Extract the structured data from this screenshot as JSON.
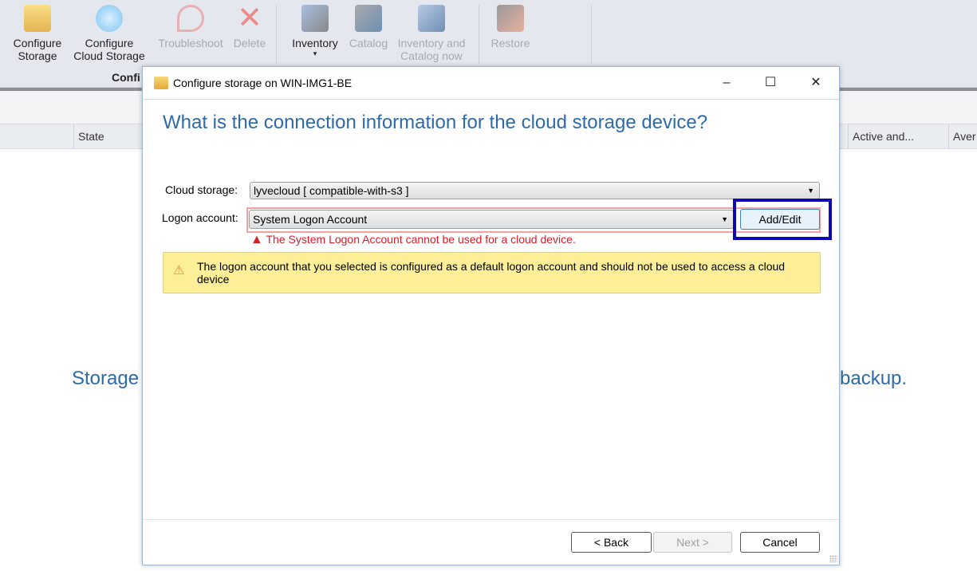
{
  "ribbon": {
    "buttons": [
      {
        "label": "Configure Storage",
        "enabled": true
      },
      {
        "label": "Configure Cloud Storage",
        "enabled": true
      },
      {
        "label": "Troubleshoot",
        "enabled": false
      },
      {
        "label": "Delete",
        "enabled": false
      },
      {
        "label": "Inventory",
        "enabled": true,
        "dropdown": "▾"
      },
      {
        "label": "Catalog",
        "enabled": false
      },
      {
        "label": "Inventory and Catalog now",
        "enabled": false
      },
      {
        "label": "Restore",
        "enabled": false
      }
    ],
    "group_label": "Confi"
  },
  "columns": [
    "State",
    "Active and...",
    "Aver"
  ],
  "background_text": {
    "left": "Storage",
    "right": "backup."
  },
  "dialog": {
    "title": "Configure storage on WIN-IMG1-BE",
    "question": "What is the connection information for the cloud storage device?",
    "cloud_storage_label": "Cloud storage:",
    "cloud_storage_value": "lyvecloud  [ compatible-with-s3 ]",
    "logon_label": "Logon account:",
    "logon_value": "System Logon Account",
    "add_edit": "Add/Edit",
    "error": "The System Logon Account cannot be used for a cloud device.",
    "warning": "The logon account that you selected is configured as a default logon account and should not be used to access a cloud device",
    "back": "< Back",
    "next": "Next >",
    "cancel": "Cancel"
  },
  "colors": {
    "accent": "#2d6aa8",
    "error": "#e0192a",
    "highlight": "#0c0ab2",
    "warning_bg": "#fdee98"
  }
}
